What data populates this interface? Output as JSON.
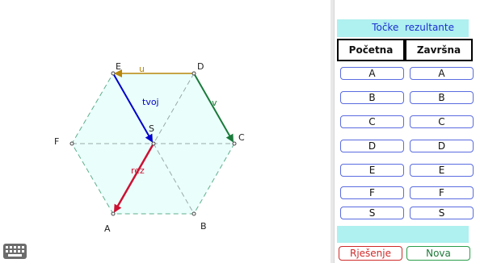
{
  "diagram": {
    "points": [
      {
        "id": "E",
        "label": "E"
      },
      {
        "id": "D",
        "label": "D"
      },
      {
        "id": "C",
        "label": "C"
      },
      {
        "id": "B",
        "label": "B"
      },
      {
        "id": "A",
        "label": "A"
      },
      {
        "id": "F",
        "label": "F"
      },
      {
        "id": "S",
        "label": "S"
      }
    ],
    "vectors": [
      {
        "id": "u",
        "label": "u",
        "color": "#b8860b"
      },
      {
        "id": "v",
        "label": "v",
        "color": "#1a7a3a"
      },
      {
        "id": "tvoj",
        "label": "tvoj",
        "color": "#0000cc"
      },
      {
        "id": "rez",
        "label": "rez",
        "color": "#cc1133"
      }
    ],
    "hexagon_fill": "#eafffb",
    "hexagon_stroke": "#5fae8d"
  },
  "panel": {
    "title": "Točke  rezultante",
    "header_start": "Početna",
    "header_end": "Završna",
    "start_points": [
      "A",
      "B",
      "C",
      "D",
      "E",
      "F",
      "S"
    ],
    "end_points": [
      "A",
      "B",
      "C",
      "D",
      "E",
      "F",
      "S"
    ],
    "solution_label": "Rješenje",
    "new_label": "Nova"
  },
  "colors": {
    "accent_band": "#aff0f0",
    "title_text": "#1a2fd1",
    "button_border": "#5a6ce0",
    "solution_color": "#d02a2a",
    "new_color": "#1f7a3a"
  }
}
